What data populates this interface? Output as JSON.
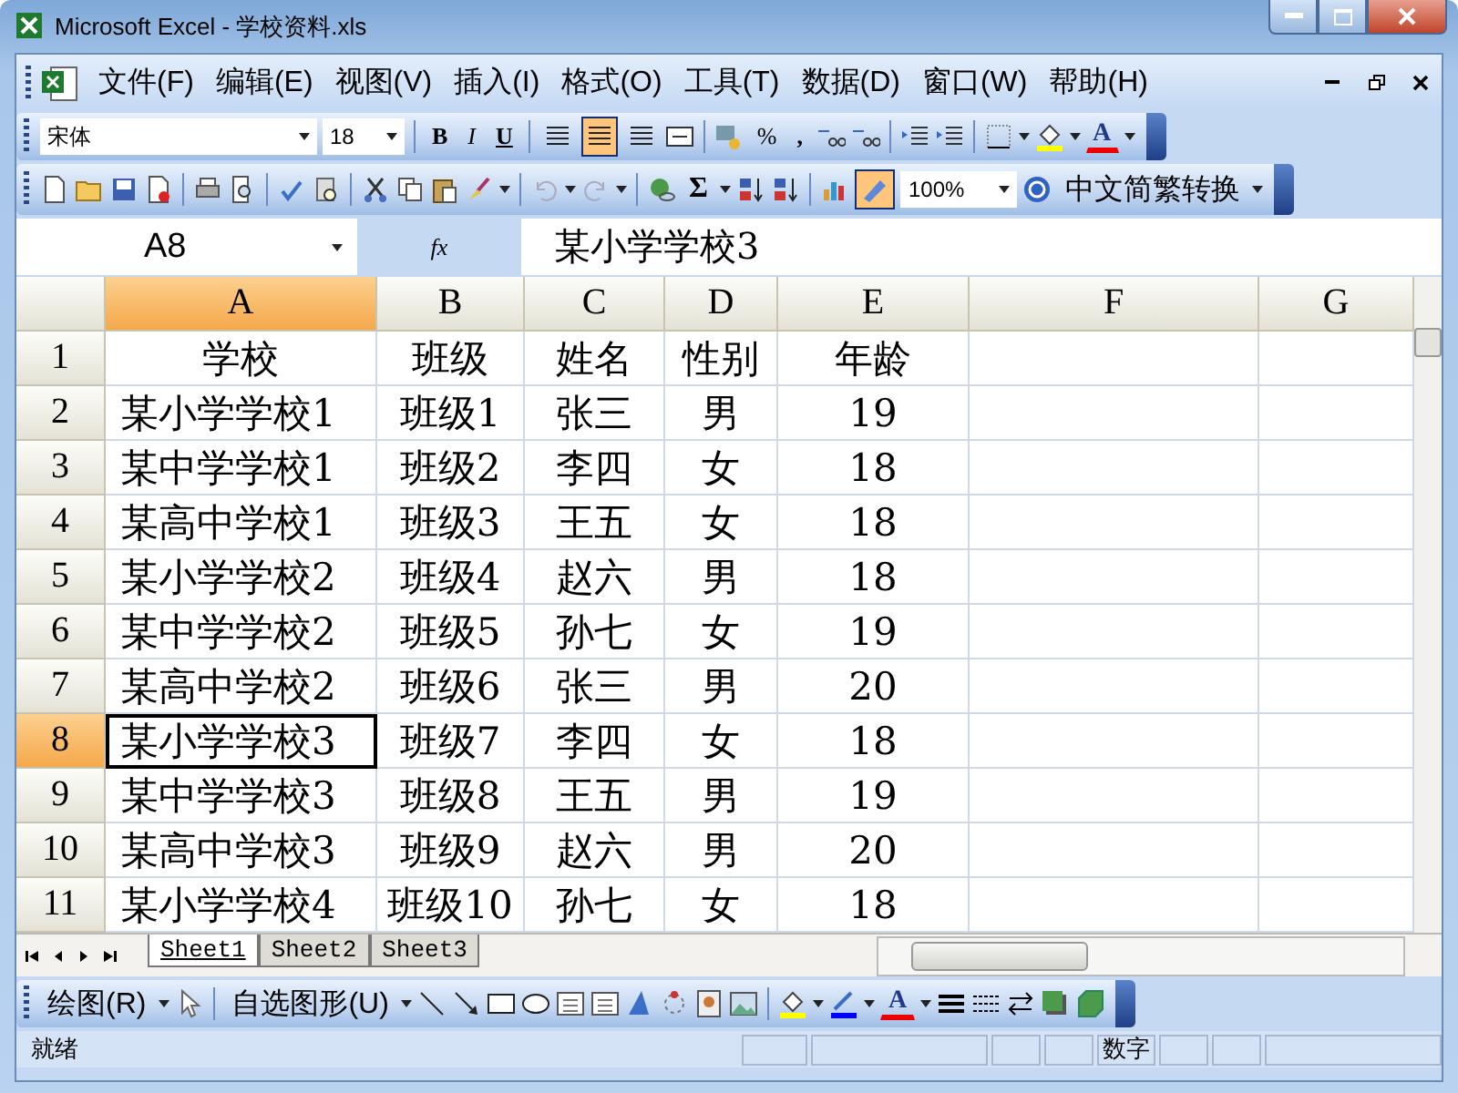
{
  "window": {
    "title": "Microsoft Excel - 学校资料.xls"
  },
  "menu": [
    {
      "label": "文件(F)"
    },
    {
      "label": "编辑(E)"
    },
    {
      "label": "视图(V)"
    },
    {
      "label": "插入(I)"
    },
    {
      "label": "格式(O)"
    },
    {
      "label": "工具(T)"
    },
    {
      "label": "数据(D)"
    },
    {
      "label": "窗口(W)"
    },
    {
      "label": "帮助(H)"
    }
  ],
  "formatting_toolbar": {
    "font": "宋体",
    "size": "18",
    "styles": [
      {
        "label": "B",
        "kind": "bold"
      },
      {
        "label": "I",
        "kind": "italic"
      },
      {
        "label": "U",
        "kind": "underline"
      }
    ],
    "alignment": [
      {
        "selected": false
      },
      {
        "selected": true
      },
      {
        "selected": false
      }
    ],
    "percent": "%",
    "comma": ",",
    "font_color": "A"
  },
  "standard_toolbar": {
    "sum": "Σ",
    "zoom": "100%",
    "convert": "中文简繁转换"
  },
  "formula_bar": {
    "name_box": "A8",
    "fx": "fx",
    "formula": "某小学学校3"
  },
  "columns": [
    {
      "label": "A",
      "selected": true
    },
    {
      "label": "B",
      "selected": false
    },
    {
      "label": "C",
      "selected": false
    },
    {
      "label": "D",
      "selected": false
    },
    {
      "label": "E",
      "selected": false
    },
    {
      "label": "F",
      "selected": false
    },
    {
      "label": "G",
      "selected": false
    }
  ],
  "rows": [
    {
      "header": "1",
      "selected": false,
      "cells": [
        "学校",
        "班级",
        "姓名",
        "性别",
        "年龄"
      ]
    },
    {
      "header": "2",
      "selected": false,
      "cells": [
        "某小学学校1",
        "班级1",
        "张三",
        "男",
        "19"
      ]
    },
    {
      "header": "3",
      "selected": false,
      "cells": [
        "某中学学校1",
        "班级2",
        "李四",
        "女",
        "18"
      ]
    },
    {
      "header": "4",
      "selected": false,
      "cells": [
        "某高中学校1",
        "班级3",
        "王五",
        "女",
        "18"
      ]
    },
    {
      "header": "5",
      "selected": false,
      "cells": [
        "某小学学校2",
        "班级4",
        "赵六",
        "男",
        "18"
      ]
    },
    {
      "header": "6",
      "selected": false,
      "cells": [
        "某中学学校2",
        "班级5",
        "孙七",
        "女",
        "19"
      ]
    },
    {
      "header": "7",
      "selected": false,
      "cells": [
        "某高中学校2",
        "班级6",
        "张三",
        "男",
        "20"
      ]
    },
    {
      "header": "8",
      "selected": true,
      "cells": [
        "某小学学校3",
        "班级7",
        "李四",
        "女",
        "18"
      ]
    },
    {
      "header": "9",
      "selected": false,
      "cells": [
        "某中学学校3",
        "班级8",
        "王五",
        "男",
        "19"
      ]
    },
    {
      "header": "10",
      "selected": false,
      "cells": [
        "某高中学校3",
        "班级9",
        "赵六",
        "男",
        "20"
      ]
    },
    {
      "header": "11",
      "selected": false,
      "cells": [
        "某小学学校4",
        "班级10",
        "孙七",
        "女",
        "18"
      ]
    }
  ],
  "sheet_tabs": [
    {
      "label": "Sheet1",
      "selected": true
    },
    {
      "label": "Sheet2",
      "selected": false
    },
    {
      "label": "Sheet3",
      "selected": false
    }
  ],
  "drawing_toolbar": {
    "draw": "绘图(R)",
    "autoshapes": "自选图形(U)",
    "font_color": "A"
  },
  "status_bar": {
    "status": "就绪",
    "mode": "数字"
  }
}
